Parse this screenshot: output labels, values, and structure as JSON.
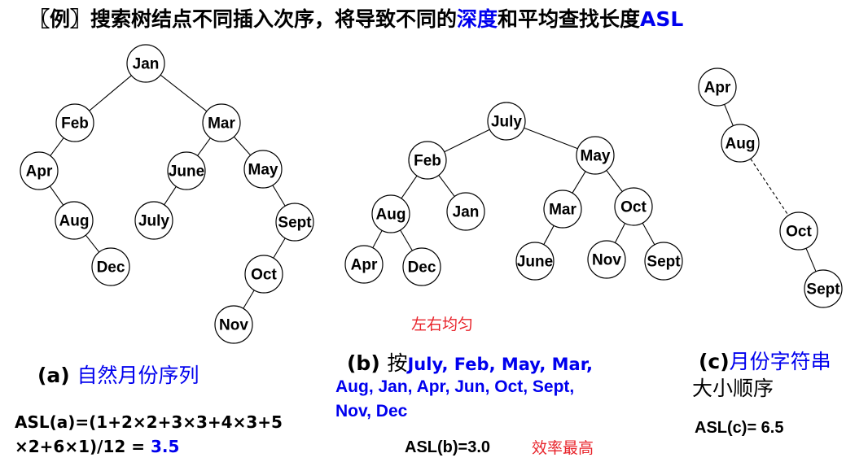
{
  "title": {
    "prefix": "〖例〗搜索树结点不同插入次序，将导致不同的",
    "depth_word": "深度",
    "middle": "和平均查找长度",
    "asl_word": "ASL"
  },
  "trees": {
    "a": {
      "nodes": [
        {
          "id": "jan",
          "label": "Jan"
        },
        {
          "id": "feb",
          "label": "Feb"
        },
        {
          "id": "mar",
          "label": "Mar"
        },
        {
          "id": "apr",
          "label": "Apr"
        },
        {
          "id": "june",
          "label": "June"
        },
        {
          "id": "may",
          "label": "May"
        },
        {
          "id": "aug",
          "label": "Aug"
        },
        {
          "id": "july",
          "label": "July"
        },
        {
          "id": "sept",
          "label": "Sept"
        },
        {
          "id": "dec",
          "label": "Dec"
        },
        {
          "id": "oct",
          "label": "Oct"
        },
        {
          "id": "nov",
          "label": "Nov"
        }
      ],
      "edges": [
        [
          "jan",
          "feb"
        ],
        [
          "jan",
          "mar"
        ],
        [
          "feb",
          "apr"
        ],
        [
          "apr",
          "aug"
        ],
        [
          "aug",
          "dec"
        ],
        [
          "mar",
          "june"
        ],
        [
          "june",
          "july"
        ],
        [
          "mar",
          "may"
        ],
        [
          "may",
          "sept"
        ],
        [
          "sept",
          "oct"
        ],
        [
          "oct",
          "nov"
        ]
      ],
      "caption_label": "(a)",
      "caption_text": "自然月份序列",
      "asl_line1": "ASL(a)=(1+2×2+3×3+4×3+5",
      "asl_line2_prefix": "×2+6×1)/12 = ",
      "asl_value": "3.5"
    },
    "b": {
      "nodes": [
        {
          "id": "july",
          "label": "July"
        },
        {
          "id": "feb",
          "label": "Feb"
        },
        {
          "id": "may",
          "label": "May"
        },
        {
          "id": "aug",
          "label": "Aug"
        },
        {
          "id": "jan",
          "label": "Jan"
        },
        {
          "id": "mar",
          "label": "Mar"
        },
        {
          "id": "oct",
          "label": "Oct"
        },
        {
          "id": "apr",
          "label": "Apr"
        },
        {
          "id": "dec",
          "label": "Dec"
        },
        {
          "id": "june",
          "label": "June"
        },
        {
          "id": "nov",
          "label": "Nov"
        },
        {
          "id": "sept",
          "label": "Sept"
        }
      ],
      "edges": [
        [
          "july",
          "feb"
        ],
        [
          "july",
          "may"
        ],
        [
          "feb",
          "aug"
        ],
        [
          "feb",
          "jan"
        ],
        [
          "aug",
          "apr"
        ],
        [
          "aug",
          "dec"
        ],
        [
          "may",
          "mar"
        ],
        [
          "may",
          "oct"
        ],
        [
          "mar",
          "june"
        ],
        [
          "oct",
          "nov"
        ],
        [
          "oct",
          "sept"
        ]
      ],
      "note_balanced": "左右均匀",
      "caption_label": "(b)",
      "caption_prefix": "按",
      "caption_line1": "July, Feb, May, Mar,",
      "caption_line2": "Aug, Jan, Apr, Jun, Oct, Sept,",
      "caption_line3": "Nov, Dec",
      "asl": "ASL(b)=3.0",
      "note_efficiency": "效率最高"
    },
    "c": {
      "nodes": [
        {
          "id": "apr",
          "label": "Apr"
        },
        {
          "id": "aug",
          "label": "Aug"
        },
        {
          "id": "oct",
          "label": "Oct"
        },
        {
          "id": "sept",
          "label": "Sept"
        }
      ],
      "edges": [
        [
          "apr",
          "aug"
        ],
        [
          "oct",
          "sept"
        ]
      ],
      "dashed_edges": [
        [
          "aug",
          "oct"
        ]
      ],
      "caption_label": "(c)",
      "caption_text": "月份字符串",
      "caption_line2": "大小顺序",
      "asl": "ASL(c)= 6.5"
    }
  },
  "colors": {
    "blue": "#0000ee",
    "red": "#e8232a",
    "black": "#000000"
  }
}
